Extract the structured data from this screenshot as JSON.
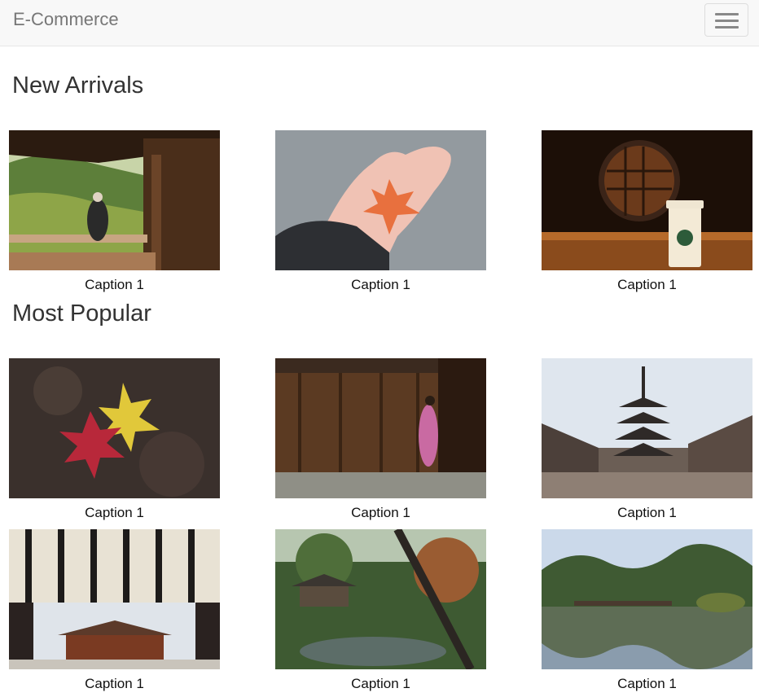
{
  "navbar": {
    "brand": "E-Commerce",
    "toggle_icon": "hamburger-menu-icon"
  },
  "sections": [
    {
      "title": "New Arrivals",
      "items": [
        {
          "caption": "Caption 1",
          "image": "wooden-temple-veranda-with-monk-photo"
        },
        {
          "caption": "Caption 1",
          "image": "hand-holding-red-maple-leaf-photo"
        },
        {
          "caption": "Caption 1",
          "image": "round-window-with-coffee-cup-photo"
        }
      ]
    },
    {
      "title": "Most Popular",
      "items": [
        {
          "caption": "Caption 1",
          "image": "maple-leaves-on-stone-photo"
        },
        {
          "caption": "Caption 1",
          "image": "kimono-woman-by-wooden-wall-photo"
        },
        {
          "caption": "Caption 1",
          "image": "pagoda-street-photo"
        },
        {
          "caption": "Caption 1",
          "image": "temple-gate-curtain-photo"
        },
        {
          "caption": "Caption 1",
          "image": "japanese-garden-pond-photo"
        },
        {
          "caption": "Caption 1",
          "image": "reflecting-pond-photo"
        }
      ]
    }
  ]
}
